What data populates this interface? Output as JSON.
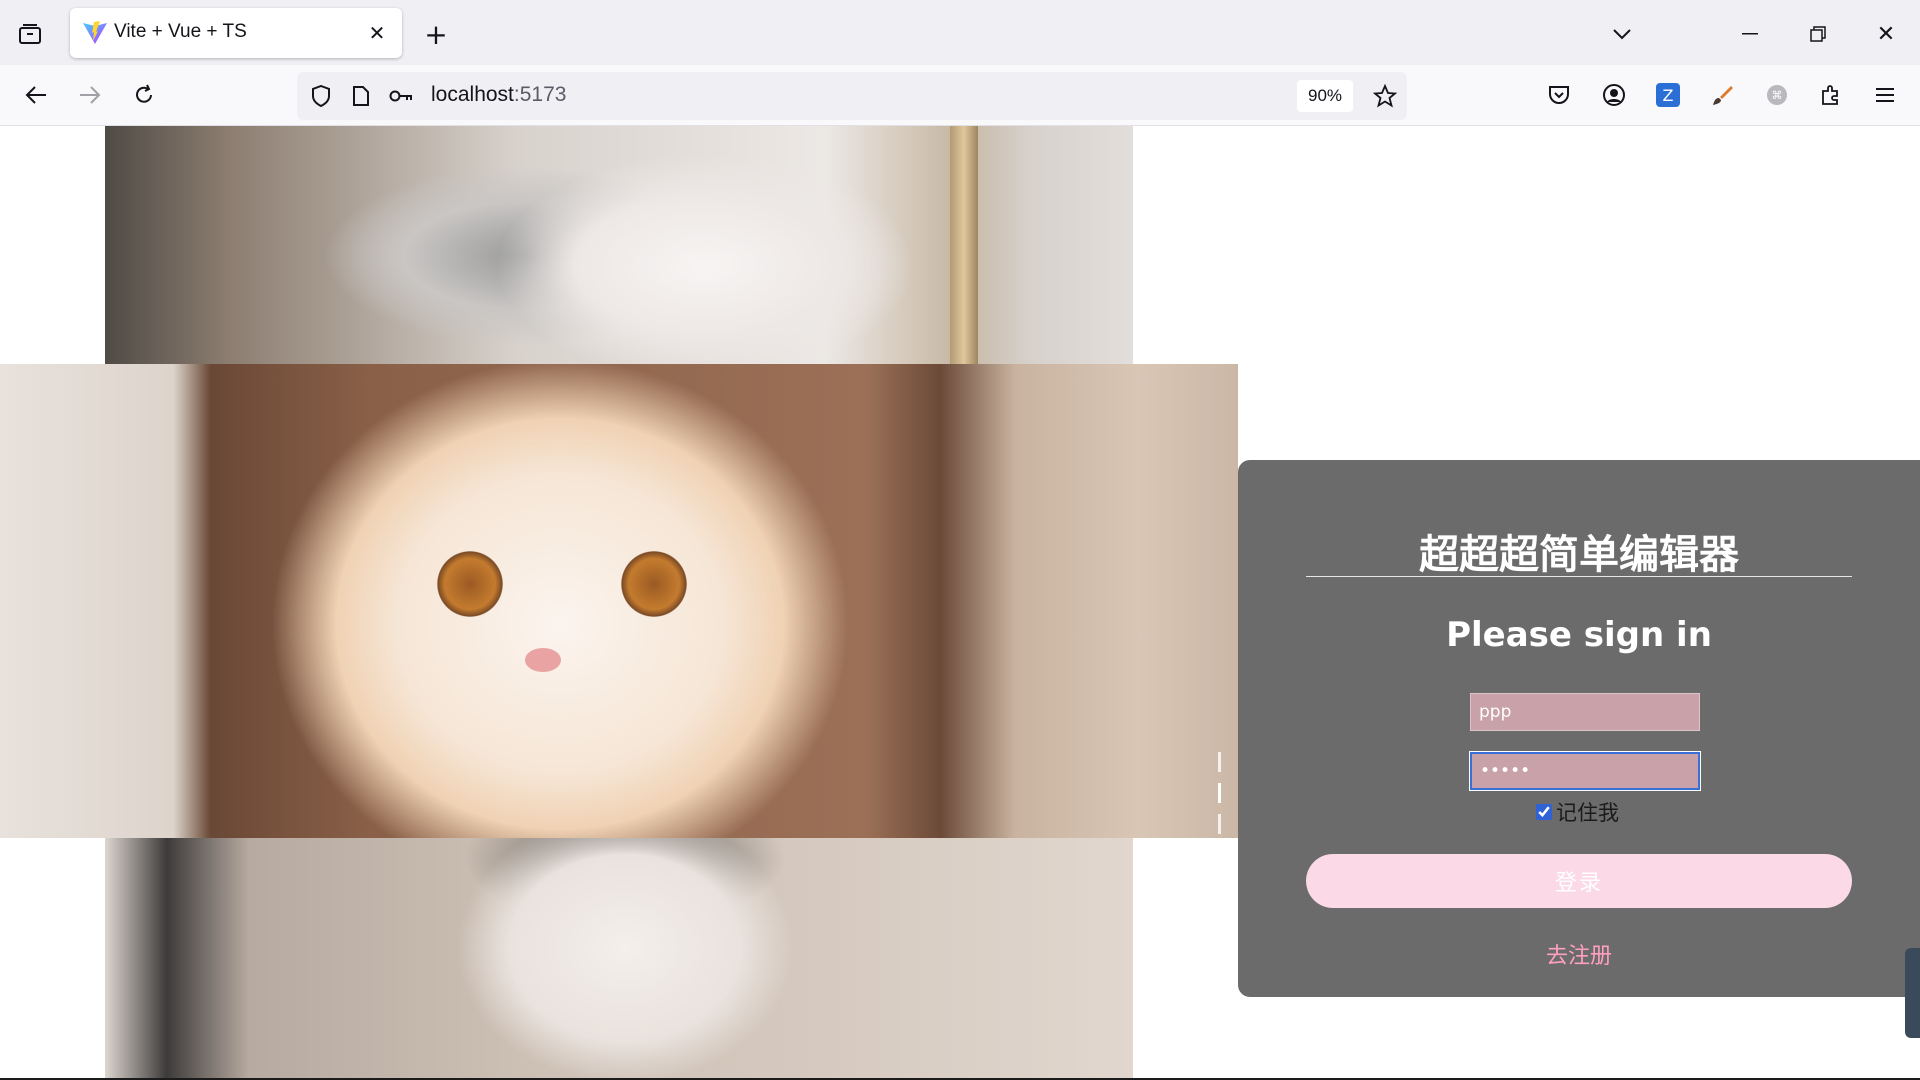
{
  "browser": {
    "tab": {
      "title": "Vite + Vue + TS"
    },
    "url": {
      "host": "localhost",
      "port": ":5173"
    },
    "zoom": "90%",
    "icons": {
      "tab_list": "tab-list-icon",
      "new_tab": "plus-icon",
      "tab_overflow": "chevron-down-icon",
      "back": "back-arrow-icon",
      "forward": "forward-arrow-icon",
      "reload": "reload-icon",
      "shield": "shield-icon",
      "page": "page-icon",
      "key": "key-icon",
      "bookmark": "star-icon",
      "pocket": "pocket-icon",
      "account": "account-icon",
      "menu": "hamburger-menu-icon"
    }
  },
  "carousel": {
    "slides": [
      "cat-top",
      "cat-mid",
      "cat-bot"
    ],
    "active_index": 1,
    "indicator_count": 6
  },
  "login": {
    "title": "超超超简单编辑器",
    "heading": "Please sign in",
    "username_value": "ppp",
    "password_value": "•••••",
    "remember_label": "记住我",
    "remember_checked": true,
    "submit_label": "登录",
    "register_link": "去注册"
  },
  "colors": {
    "card_bg": "#6b6b6b",
    "input_bg": "#c9a1a9",
    "button_bg": "#fbd9e7",
    "link": "#ff9fc2"
  }
}
